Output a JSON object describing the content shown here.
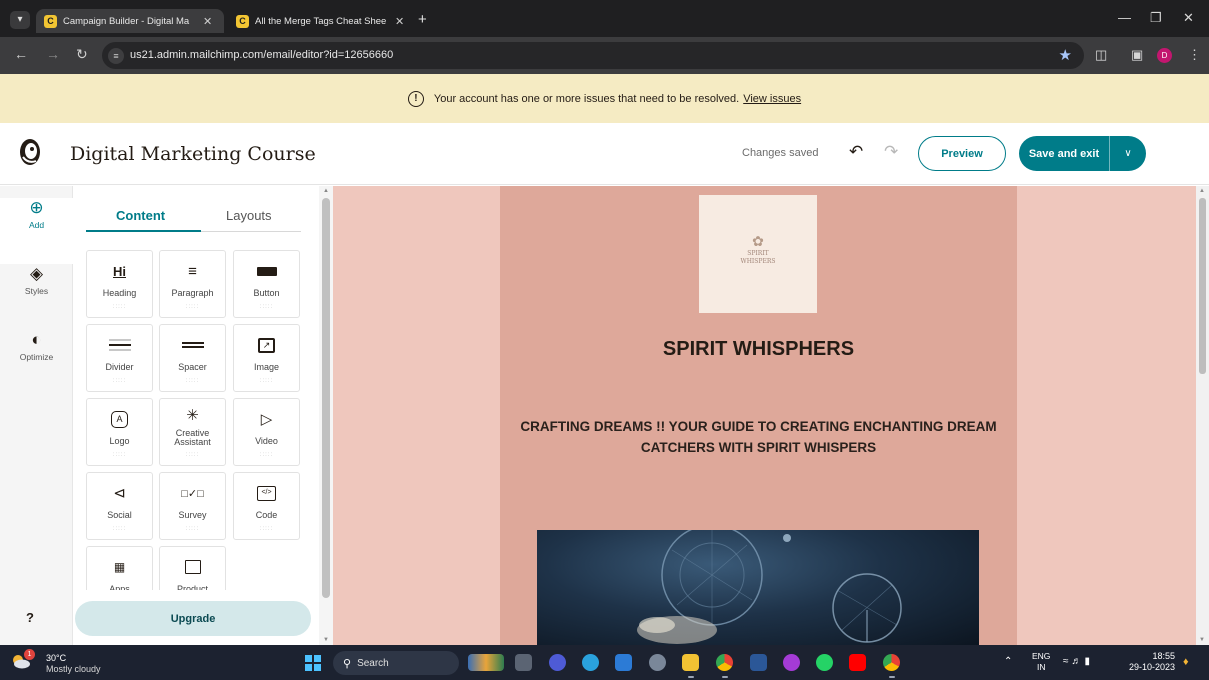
{
  "browser": {
    "tabs": [
      {
        "title": "Campaign Builder - Digital Ma",
        "active": true
      },
      {
        "title": "All the Merge Tags Cheat Shee",
        "active": false
      }
    ],
    "url": "us21.admin.mailchimp.com/email/editor?id=12656660",
    "profile_initial": "D",
    "icons": [
      "back-icon",
      "forward-icon",
      "reload-icon",
      "site-info-icon",
      "star-icon",
      "extensions-icon",
      "sidepanel-icon",
      "more-icon"
    ]
  },
  "alert": {
    "message": "Your account has one or more issues that need to be resolved.",
    "link": "View issues"
  },
  "header": {
    "title": "Digital Marketing Course",
    "status": "Changes saved",
    "preview_label": "Preview",
    "save_label": "Save and exit"
  },
  "rail": {
    "items": [
      {
        "label": "Add",
        "icon": "plus-circle-icon"
      },
      {
        "label": "Styles",
        "icon": "paint-bucket-icon"
      },
      {
        "label": "Optimize",
        "icon": "gauge-icon"
      }
    ],
    "help": "?"
  },
  "panel": {
    "tabs": [
      "Content",
      "Layouts"
    ],
    "active_tab": "Content",
    "blocks": [
      {
        "label": "Heading",
        "icon": "heading-icon",
        "glyph": "Hi"
      },
      {
        "label": "Paragraph",
        "icon": "paragraph-icon"
      },
      {
        "label": "Button",
        "icon": "button-icon"
      },
      {
        "label": "Divider",
        "icon": "divider-icon"
      },
      {
        "label": "Spacer",
        "icon": "spacer-icon"
      },
      {
        "label": "Image",
        "icon": "image-icon"
      },
      {
        "label": "Logo",
        "icon": "logo-icon",
        "glyph": "A"
      },
      {
        "label": "Creative Assistant",
        "icon": "sparkle-icon"
      },
      {
        "label": "Video",
        "icon": "video-icon"
      },
      {
        "label": "Social",
        "icon": "share-icon"
      },
      {
        "label": "Survey",
        "icon": "survey-icon"
      },
      {
        "label": "Code",
        "icon": "code-icon"
      },
      {
        "label": "Apps",
        "icon": "apps-icon"
      },
      {
        "label": "Product",
        "icon": "shopping-bag-icon"
      }
    ],
    "upgrade_label": "Upgrade"
  },
  "email": {
    "logo_text_line1": "SPIRIT",
    "logo_text_line2": "WHISPERS",
    "title": "SPIRIT WHISPHERS",
    "subtitle": "CRAFTING DREAMS !! YOUR GUIDE TO CREATING ENCHANTING DREAM CATCHERS WITH SPIRIT WHISPERS",
    "hero_image": "dream-catcher-image"
  },
  "taskbar": {
    "weather_temp": "30°C",
    "weather_desc": "Mostly cloudy",
    "weather_badge": "1",
    "search_label": "Search",
    "lang_line1": "ENG",
    "lang_line2": "IN",
    "time": "18:55",
    "date": "29-10-2023"
  },
  "colors": {
    "accent": "#007c89",
    "canvas_bg": "#efc7bd",
    "email_bg": "#dea89a",
    "alert_bg": "#f5ebc3"
  }
}
